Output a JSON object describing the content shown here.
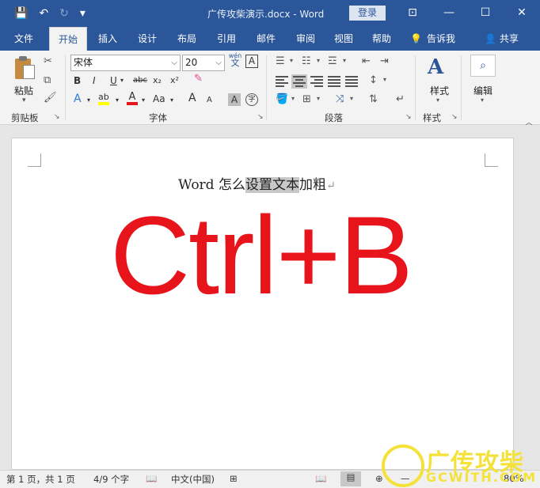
{
  "window": {
    "title": "广传攻柴演示.docx  -  Word",
    "login_label": "登录",
    "controls": [
      "⊡",
      "—",
      "☐",
      "✕"
    ]
  },
  "quick_access": [
    "💾",
    "↶",
    "↻",
    "▾"
  ],
  "tabs": [
    "文件",
    "开始",
    "插入",
    "设计",
    "布局",
    "引用",
    "邮件",
    "审阅",
    "视图",
    "帮助"
  ],
  "active_tab": "开始",
  "tell_me": "告诉我",
  "share": "共享",
  "ribbon": {
    "clipboard": {
      "label": "剪贴板",
      "paste": "粘贴"
    },
    "font": {
      "label": "字体",
      "name": "宋体",
      "size": "20",
      "pinyin": "wén",
      "pinyin_char": "文",
      "border_char": "A",
      "style_buttons": [
        "B",
        "I",
        "U",
        "abc",
        "x₂",
        "x²"
      ],
      "grow": "A",
      "shrink": "A",
      "case": "Aa",
      "shade": "A",
      "circle": "字",
      "effects": "A",
      "highlight": "ab",
      "font_color": "A"
    },
    "paragraph": {
      "label": "段落"
    },
    "styles": {
      "label": "样式",
      "icon_text": "A"
    },
    "editing": {
      "label": "编辑"
    }
  },
  "document": {
    "line_before": "Word 怎么",
    "line_selected": "设置文本",
    "line_after": "加粗",
    "paragraph_mark": "↵",
    "big_text": "Ctrl+B"
  },
  "status": {
    "page": "第 1 页，共 1 页",
    "words": "4/9 个字",
    "language": "中文(中国)",
    "zoom": "80%"
  },
  "watermark": {
    "cn": "广传攻柴",
    "en": "GCWITH.COM"
  },
  "colors": {
    "accent": "#2b579a",
    "big_text": "#e8141c",
    "selection": "#c8c8c8",
    "watermark": "#f4e23a"
  }
}
